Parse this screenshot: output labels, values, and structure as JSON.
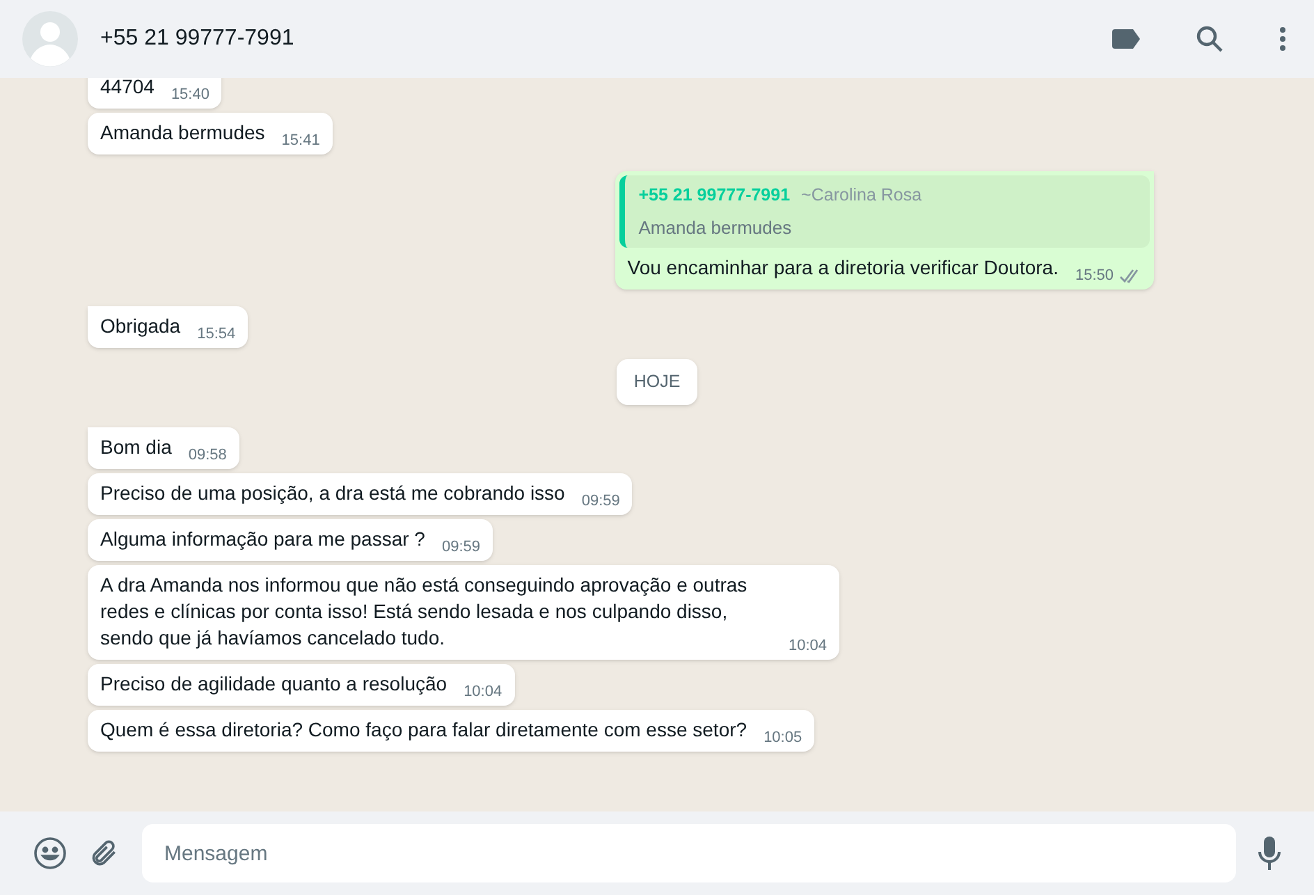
{
  "header": {
    "contact": "+55 21 99777-7991"
  },
  "messages": [
    {
      "kind": "incoming",
      "text": "44704",
      "time": "15:40"
    },
    {
      "kind": "incoming",
      "text": "Amanda bermudes",
      "time": "15:41"
    },
    {
      "kind": "outgoing",
      "quote": {
        "author": "+55 21 99777-7991",
        "name": "~Carolina Rosa",
        "text": "Amanda bermudes"
      },
      "text": "Vou encaminhar para a diretoria verificar Doutora.",
      "time": "15:50",
      "read": false
    },
    {
      "kind": "incoming",
      "text": "Obrigada",
      "time": "15:54"
    },
    {
      "kind": "date",
      "text": "HOJE"
    },
    {
      "kind": "incoming",
      "text": "Bom dia",
      "time": "09:58"
    },
    {
      "kind": "incoming",
      "text": "Preciso de uma posição, a dra está me cobrando isso",
      "time": "09:59"
    },
    {
      "kind": "incoming",
      "text": "Alguma informação para me passar ?",
      "time": "09:59"
    },
    {
      "kind": "incoming",
      "text": "A dra Amanda nos informou que não está conseguindo aprovação e outras redes e clínicas por conta isso! Está sendo lesada e nos culpando disso, sendo que já havíamos cancelado tudo.",
      "time": "10:04"
    },
    {
      "kind": "incoming",
      "text": "Preciso de agilidade quanto a resolução",
      "time": "10:04"
    },
    {
      "kind": "incoming",
      "text": "Quem é essa diretoria? Como faço para falar diretamente com esse setor?",
      "time": "10:05"
    }
  ],
  "composer": {
    "placeholder": "Mensagem"
  }
}
